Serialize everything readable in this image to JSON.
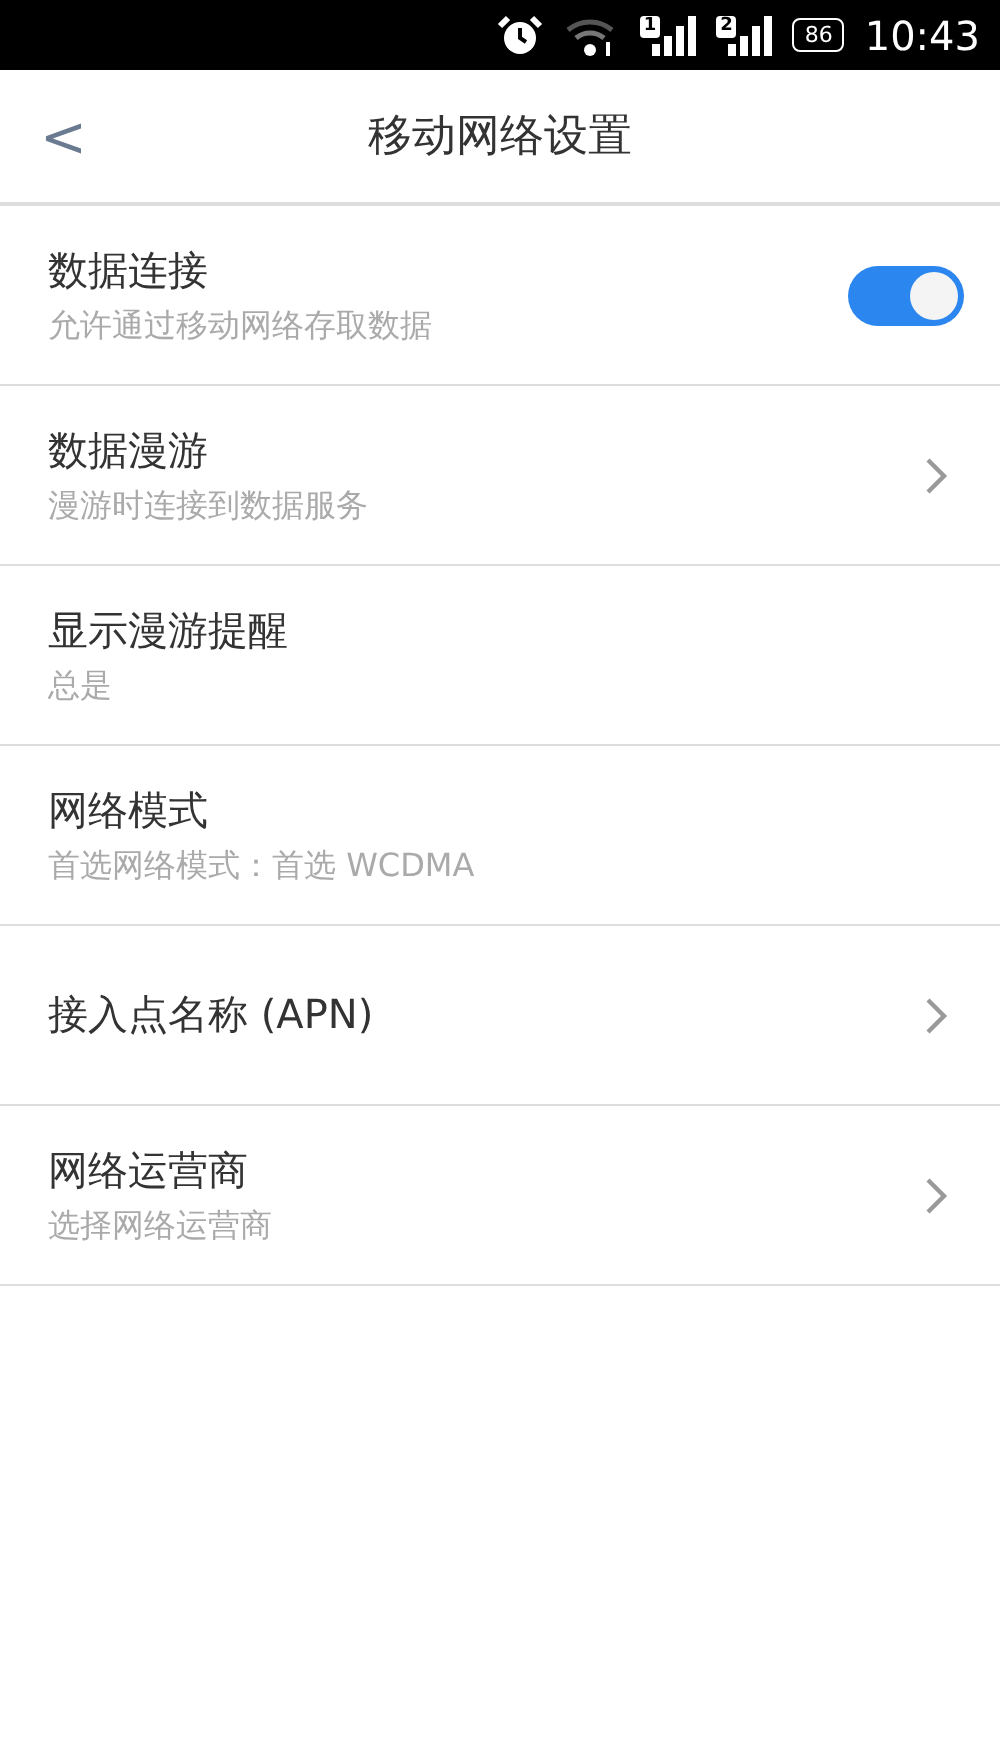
{
  "status_bar": {
    "sims": [
      "1",
      "2"
    ],
    "battery": "86",
    "time": "10:43"
  },
  "header": {
    "back": "<",
    "title": "移动网络设置"
  },
  "items": [
    {
      "kind": "toggle",
      "title": "数据连接",
      "subtitle": "允许通过移动网络存取数据",
      "on": true
    },
    {
      "kind": "chevron",
      "title": "数据漫游",
      "subtitle": "漫游时连接到数据服务"
    },
    {
      "kind": "plain",
      "title": "显示漫游提醒",
      "subtitle": "总是"
    },
    {
      "kind": "plain",
      "title": "网络模式",
      "subtitle": "首选网络模式：首选 WCDMA"
    },
    {
      "kind": "chevron",
      "title": "接入点名称 (APN)"
    },
    {
      "kind": "chevron",
      "title": "网络运营商",
      "subtitle": "选择网络运营商"
    }
  ]
}
